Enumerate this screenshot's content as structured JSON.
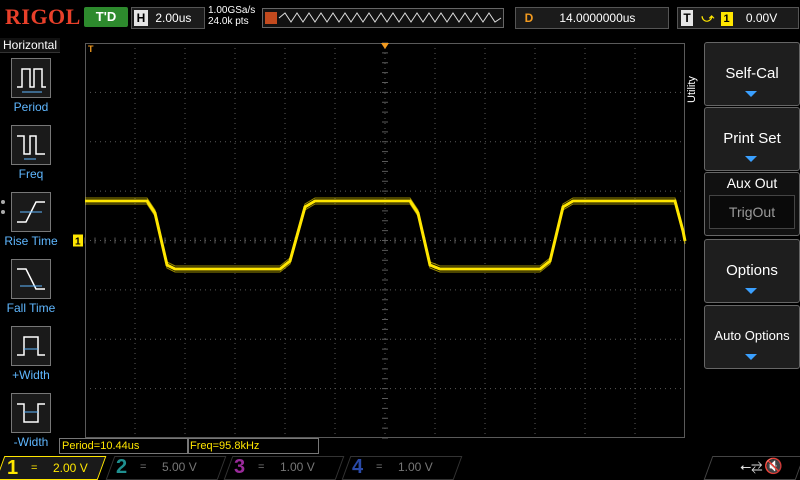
{
  "header": {
    "brand": "RIGOL",
    "trigger_status": "T'D",
    "horizontal": {
      "label": "H",
      "timebase": "2.00us"
    },
    "sample_rate": "1.00GSa/s",
    "memory_depth": "24.0k pts",
    "delay": {
      "label": "D",
      "value": "14.0000000us"
    },
    "trigger": {
      "label": "T",
      "edge": "rising",
      "source": "1",
      "level": "0.00V"
    }
  },
  "left_menu": {
    "title": "Horizontal",
    "items": [
      {
        "label": "Period",
        "icon": "period-icon"
      },
      {
        "label": "Freq",
        "icon": "frequency-icon"
      },
      {
        "label": "Rise Time",
        "icon": "rise-time-icon"
      },
      {
        "label": "Fall Time",
        "icon": "fall-time-icon"
      },
      {
        "label": "+Width",
        "icon": "positive-width-icon"
      },
      {
        "label": "-Width",
        "icon": "negative-width-icon"
      }
    ]
  },
  "right_menu": {
    "title": "Utility",
    "buttons": [
      {
        "label": "Self-Cal"
      },
      {
        "label": "Print Set"
      },
      {
        "label": "Aux Out",
        "value": "TrigOut"
      },
      {
        "label": "Options"
      },
      {
        "label": "Auto Options"
      }
    ]
  },
  "measurements": [
    {
      "text": "Period=10.44us"
    },
    {
      "text": "Freq=95.8kHz"
    }
  ],
  "channels": [
    {
      "num": "1",
      "coupling": "=",
      "scale": "2.00 V",
      "color": "#ffe600",
      "active": true
    },
    {
      "num": "2",
      "coupling": "=",
      "scale": "5.00 V",
      "color": "#1f8f8f",
      "active": false
    },
    {
      "num": "3",
      "coupling": "=",
      "scale": "1.00 V",
      "color": "#9a2a9a",
      "active": false
    },
    {
      "num": "4",
      "coupling": "=",
      "scale": "1.00 V",
      "color": "#2a4aa8",
      "active": false
    }
  ],
  "markers": {
    "channel1_ground": "1",
    "trigger_level": "T"
  },
  "colors": {
    "trace": "#ffe600",
    "grid": "#5a5a5a",
    "menu_text": "#5fb7ff",
    "delay": "#f29a1f"
  }
}
